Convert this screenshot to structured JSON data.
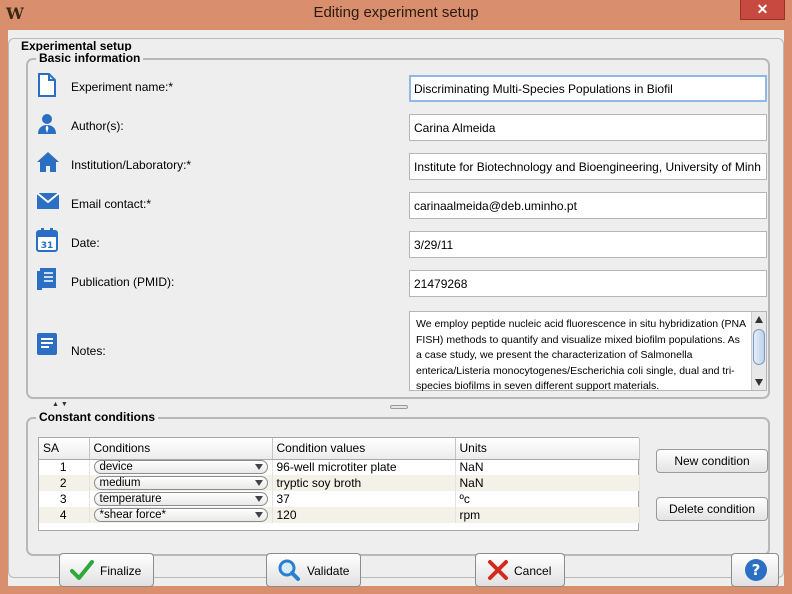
{
  "window": {
    "title": "Editing experiment setup",
    "app_icon": "W",
    "close_label": "✕",
    "colors": {
      "frame": "#d98e6d",
      "close": "#c7493f"
    }
  },
  "outer_group": {
    "title": "Experimental setup"
  },
  "basic": {
    "title": "Basic information",
    "rows": [
      {
        "icon": "document-icon",
        "label": "Experiment name:*",
        "value": "Discriminating Multi-Species Populations in Biofil"
      },
      {
        "icon": "person-icon",
        "label": "Author(s):",
        "value": "Carina Almeida"
      },
      {
        "icon": "home-icon",
        "label": "Institution/Laboratory:*",
        "value": "Institute for Biotechnology and Bioengineering, University of Minh"
      },
      {
        "icon": "envelope-icon",
        "label": "Email contact:*",
        "value": "carinaalmeida@deb.uminho.pt"
      },
      {
        "icon": "calendar-icon",
        "label": "Date:",
        "value": "3/29/11",
        "calendar_day": "31"
      },
      {
        "icon": "publication-icon",
        "label": "Publication (PMID):",
        "value": "21479268"
      }
    ],
    "notes": {
      "label": "Notes:",
      "value": "We employ peptide nucleic acid fluorescence in situ hybridization (PNA FISH) methods to quantify and visualize mixed biofilm populations. As a case study, we present the characterization of Salmonella enterica/Listeria monocytogenes/Escherichia coli single, dual and tri-species biofilms in seven different support materials."
    }
  },
  "constant": {
    "title": "Constant conditions",
    "columns": [
      "SA",
      "Conditions",
      "Condition values",
      "Units"
    ],
    "rows": [
      {
        "sa": "1",
        "condition": "device",
        "value": "96-well microtiter plate",
        "unit": "NaN"
      },
      {
        "sa": "2",
        "condition": "medium",
        "value": "tryptic soy broth",
        "unit": "NaN"
      },
      {
        "sa": "3",
        "condition": "temperature",
        "value": "37",
        "unit": "ºc"
      },
      {
        "sa": "4",
        "condition": "*shear force*",
        "value": "120",
        "unit": "rpm"
      }
    ],
    "new_condition": "New condition",
    "delete_condition": "Delete condition"
  },
  "buttons": {
    "finalize": "Finalize",
    "validate": "Validate",
    "cancel": "Cancel",
    "help": "?"
  },
  "colors": {
    "accent": "#2a7fd0",
    "check": "#2ea83a",
    "cancel": "#d32a1f"
  }
}
